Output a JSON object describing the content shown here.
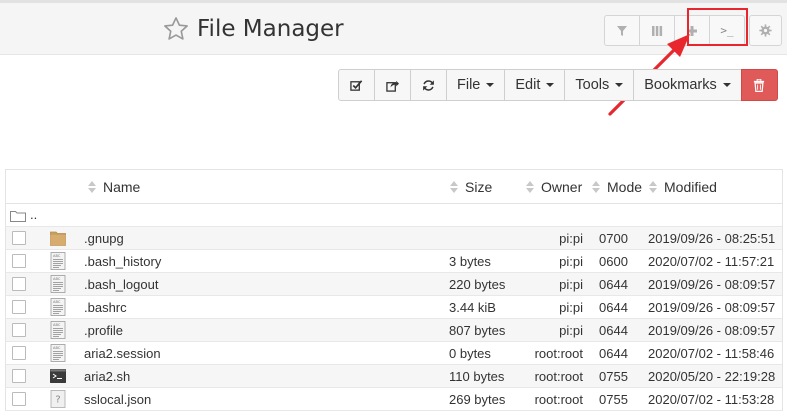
{
  "header": {
    "title": "File Manager",
    "buttons": [
      "filter-icon",
      "columns-icon",
      "plus-icon",
      "terminal-icon",
      "gear-icon"
    ],
    "terminal_glyph": ">_"
  },
  "toolbar": {
    "file_label": "File",
    "edit_label": "Edit",
    "tools_label": "Tools",
    "bookmarks_label": "Bookmarks"
  },
  "table": {
    "columns": {
      "name": "Name",
      "size": "Size",
      "owner": "Owner",
      "mode": "Mode",
      "modified": "Modified"
    },
    "parent": "..",
    "rows": [
      {
        "icon": "folder-icon",
        "name": ".gnupg",
        "size": "",
        "owner": "pi:pi",
        "mode": "0700",
        "modified": "2019/09/26 - 08:25:51"
      },
      {
        "icon": "text-file-icon",
        "name": ".bash_history",
        "size": "3 bytes",
        "owner": "pi:pi",
        "mode": "0600",
        "modified": "2020/07/02 - 11:57:21"
      },
      {
        "icon": "text-file-icon",
        "name": ".bash_logout",
        "size": "220 bytes",
        "owner": "pi:pi",
        "mode": "0644",
        "modified": "2019/09/26 - 08:09:57"
      },
      {
        "icon": "text-file-icon",
        "name": ".bashrc",
        "size": "3.44 kiB",
        "owner": "pi:pi",
        "mode": "0644",
        "modified": "2019/09/26 - 08:09:57"
      },
      {
        "icon": "text-file-icon",
        "name": ".profile",
        "size": "807 bytes",
        "owner": "pi:pi",
        "mode": "0644",
        "modified": "2019/09/26 - 08:09:57"
      },
      {
        "icon": "text-file-icon",
        "name": "aria2.session",
        "size": "0 bytes",
        "owner": "root:root",
        "mode": "0644",
        "modified": "2020/07/02 - 11:58:46"
      },
      {
        "icon": "script-file-icon",
        "name": "aria2.sh",
        "size": "110 bytes",
        "owner": "root:root",
        "mode": "0755",
        "modified": "2020/05/20 - 22:19:28"
      },
      {
        "icon": "unknown-file-icon",
        "name": "sslocal.json",
        "size": "269 bytes",
        "owner": "root:root",
        "mode": "0755",
        "modified": "2020/07/02 - 11:53:28"
      }
    ]
  },
  "colors": {
    "highlight": "#e8262d",
    "danger": "#e05a5a"
  }
}
